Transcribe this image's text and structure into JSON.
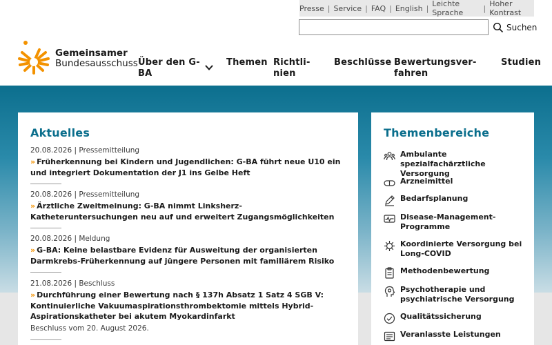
{
  "utility_nav": [
    "Presse",
    "Service",
    "FAQ",
    "English",
    "Leichte Sprache",
    "Hoher Kontrast"
  ],
  "search": {
    "button_label": "Suchen",
    "value": ""
  },
  "logo": {
    "line1": "Gemeinsamer",
    "line2": "Bundesausschuss"
  },
  "main_nav": [
    {
      "line1": "Über den G-",
      "line2": "BA"
    },
    {
      "line1": "Themen",
      "line2": ""
    },
    {
      "line1": "Richtli-",
      "line2": "nien"
    },
    {
      "line1": "Beschlüsse",
      "line2": ""
    },
    {
      "line1": "Bewertungsver-",
      "line2": "fahren"
    },
    {
      "line1": "Studien",
      "line2": ""
    }
  ],
  "news": {
    "heading": "Aktuelles",
    "items": [
      {
        "meta": "20.08.2026 | Pressemitteilung",
        "title": "Früherkennung bei Kindern und Jugendlichen: G-BA führt neue U10 ein und integriert Dokumentation der J1 ins Gelbe Heft",
        "note": ""
      },
      {
        "meta": "20.08.2026 | Pressemitteilung",
        "title": "Ärztliche Zweitmeinung: G-BA nimmt Linksherz-Katheteruntersuchungen neu auf und erweitert Zugangsmöglichkeiten",
        "note": ""
      },
      {
        "meta": "20.08.2026 | Meldung",
        "title": "G-BA: Keine belastbare Evidenz für Ausweitung der organisierten Darmkrebs-Früherkennung auf jüngere Personen mit familiärem Risiko",
        "note": ""
      },
      {
        "meta": "21.08.2026 | Beschluss",
        "title": "Durchführung einer Bewertung nach § 137h Absatz 1 Satz 4 SGB V: Kontinuierliche Vakuumaspirationsthrombektomie mittels Hybrid-Aspirationskatheter bei akutem Myokardinfarkt",
        "note": "Beschluss vom 20. August 2026."
      }
    ]
  },
  "topics": {
    "heading": "Themenbereiche",
    "items": [
      {
        "label": "Ambulante spezialfachärztliche Versorgung",
        "icon": "people-group-icon"
      },
      {
        "label": "Arzneimittel",
        "icon": "pill-icon"
      },
      {
        "label": "Bedarfsplanung",
        "icon": "pencil-icon"
      },
      {
        "label": "Disease-Management-Programme",
        "icon": "pulse-monitor-icon"
      },
      {
        "label": "Koordinierte Versorgung bei Long-COVID",
        "icon": "virus-icon"
      },
      {
        "label": "Methodenbewertung",
        "icon": "clipboard-icon"
      },
      {
        "label": "Psychotherapie und psychiatrische Versorgung",
        "icon": "head-icon"
      },
      {
        "label": "Qualitätssicherung",
        "icon": "check-circle-icon"
      },
      {
        "label": "Veranlasste Leistungen",
        "icon": "document-icon"
      }
    ]
  },
  "colors": {
    "accent": "#0a6e8c",
    "arrow": "#f39200",
    "band": "#0c6f8e"
  }
}
